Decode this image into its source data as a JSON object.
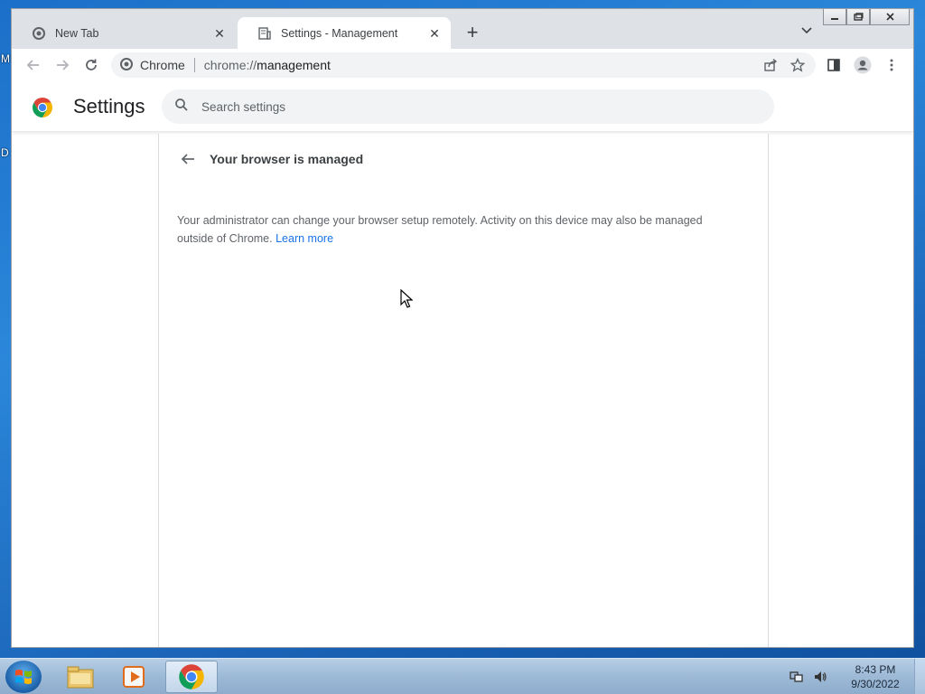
{
  "desktop": {
    "glyph_top": "M",
    "glyph_mid": "D"
  },
  "browser": {
    "tabs": [
      {
        "title": "New Tab",
        "icon": "chrome-icon",
        "active": false
      },
      {
        "title": "Settings - Management",
        "icon": "settings-page-icon",
        "active": true
      }
    ],
    "omnibox": {
      "chip": "Chrome",
      "url_prefix": "chrome://",
      "url_host": "management"
    }
  },
  "settings": {
    "title": "Settings",
    "search_placeholder": "Search settings"
  },
  "management": {
    "heading": "Your browser is managed",
    "body": "Your administrator can change your browser setup remotely. Activity on this device may also be managed outside of Chrome.",
    "learn_more": "Learn more"
  },
  "taskbar": {
    "time": "8:43 PM",
    "date": "9/30/2022"
  },
  "colors": {
    "link": "#1a73e8",
    "taskbar": "#9db9d6",
    "desktop": "#1f72cc"
  }
}
